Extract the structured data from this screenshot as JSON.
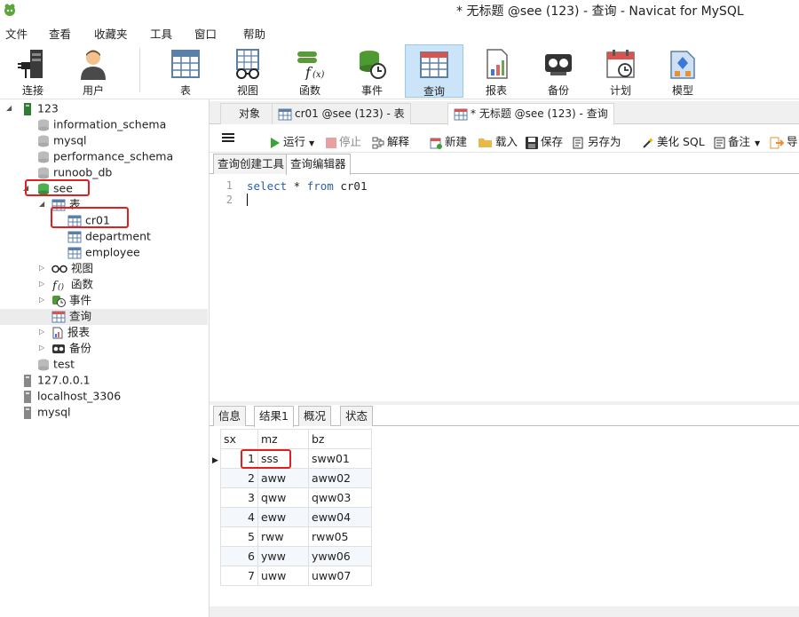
{
  "window": {
    "title": "* 无标题 @see (123) - 查询 - Navicat for MySQL"
  },
  "menu": [
    "文件",
    "查看",
    "收藏夹",
    "工具",
    "窗口",
    "帮助"
  ],
  "toolbar": {
    "connect": "连接",
    "user": "用户",
    "table": "表",
    "view": "视图",
    "function": "函数",
    "event": "事件",
    "query": "查询",
    "report": "报表",
    "backup": "备份",
    "schedule": "计划",
    "model": "模型"
  },
  "tree": {
    "conn_123": "123",
    "db_information_schema": "information_schema",
    "db_mysql": "mysql",
    "db_performance_schema": "performance_schema",
    "db_runoob": "runoob_db",
    "db_see": "see",
    "folder_tables": "表",
    "table_cr01": "cr01",
    "table_department": "department",
    "table_employee": "employee",
    "folder_views": "视图",
    "folder_functions": "函数",
    "folder_events": "事件",
    "folder_queries": "查询",
    "folder_reports": "报表",
    "folder_backups": "备份",
    "db_test": "test",
    "conn_local": "127.0.0.1",
    "conn_localhost": "localhost_3306",
    "conn_mysql": "mysql"
  },
  "doc_tabs": {
    "objects": "对象",
    "cr01_tab": "cr01 @see (123) - 表",
    "query_tab": "* 无标题 @see (123) - 查询"
  },
  "query_toolbar": {
    "run": "运行",
    "stop": "停止",
    "explain": "解释",
    "new": "新建",
    "load": "载入",
    "save": "保存",
    "save_as": "另存为",
    "beautify": "美化 SQL",
    "comment": "备注",
    "export": "导"
  },
  "editor_tabs": {
    "builder": "查询创建工具",
    "editor": "查询编辑器"
  },
  "editor": {
    "line1_no": "1",
    "line2_no": "2",
    "kw_select": "select",
    "star": " * ",
    "kw_from": "from",
    "table": " cr01"
  },
  "result_tabs": {
    "info": "信息",
    "result1": "结果1",
    "overview": "概况",
    "status": "状态"
  },
  "result": {
    "columns": [
      "sx",
      "mz",
      "bz"
    ],
    "rows": [
      [
        "1",
        "sss",
        "sww01"
      ],
      [
        "2",
        "aww",
        "aww02"
      ],
      [
        "3",
        "qww",
        "qww03"
      ],
      [
        "4",
        "eww",
        "eww04"
      ],
      [
        "5",
        "rww",
        "rww05"
      ],
      [
        "6",
        "yww",
        "yww06"
      ],
      [
        "7",
        "uww",
        "uww07"
      ]
    ]
  }
}
